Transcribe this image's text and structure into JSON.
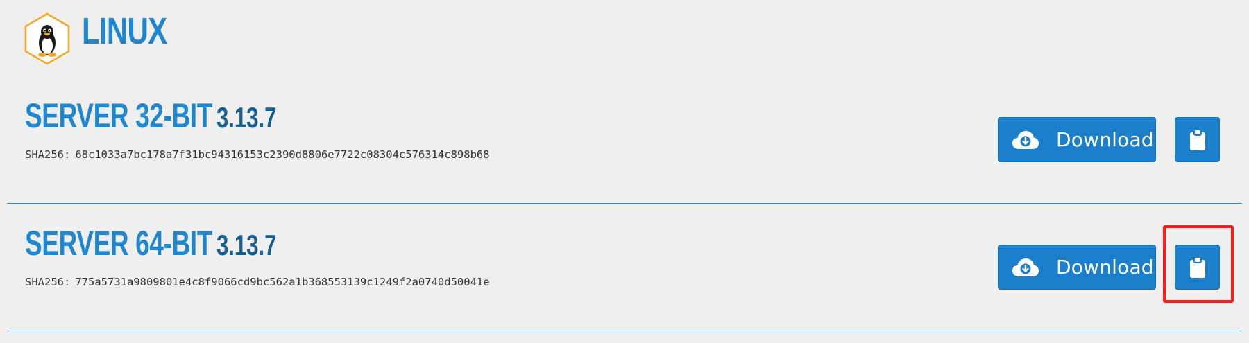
{
  "header": {
    "os_name": "LINUX",
    "logo_icon": "tux-penguin-icon",
    "accent_color": "#1f87cf",
    "logo_border_color": "#f5a623"
  },
  "releases": [
    {
      "name": "SERVER 32-BIT",
      "version": "3.13.7",
      "sha_label": "SHA256:",
      "sha_value": "68c1033a7bc178a7f31bc94316153c2390d8806e7722c08304c576314c898b68",
      "download_label": "Download",
      "download_icon": "cloud-download-icon",
      "copy_icon": "clipboard-icon"
    },
    {
      "name": "SERVER 64-BIT",
      "version": "3.13.7",
      "sha_label": "SHA256:",
      "sha_value": "775a5731a9809801e4c8f9066cd9bc562a1b368553139c1249f2a0740d50041e",
      "download_label": "Download",
      "download_icon": "cloud-download-icon",
      "copy_icon": "clipboard-icon"
    }
  ],
  "colors": {
    "button_blue": "#1b7fcb",
    "version_dark_blue": "#175f8f",
    "divider_blue": "#2a88cc",
    "highlight_red": "#ff1a1a",
    "page_background": "#efefef"
  }
}
